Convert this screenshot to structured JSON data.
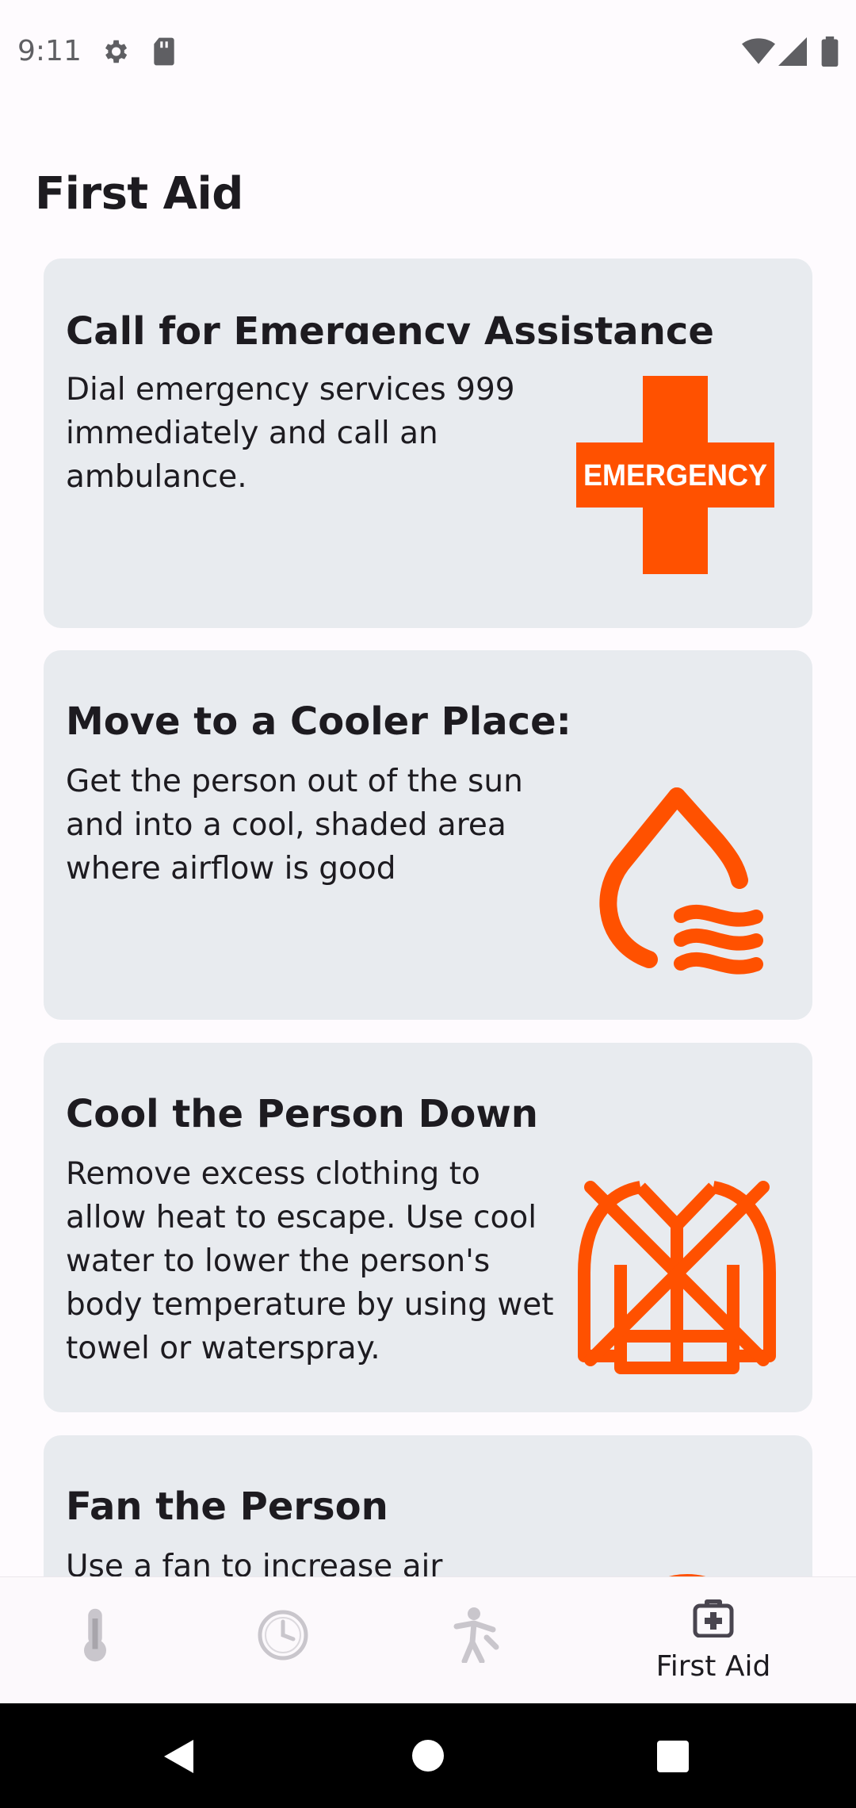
{
  "status_bar": {
    "time": "9:11",
    "icons": [
      "gear-icon",
      "sd-card-icon",
      "wifi-icon",
      "signal-icon",
      "battery-icon"
    ]
  },
  "page": {
    "title": "First Aid"
  },
  "cards": [
    {
      "title": "Call for Emergency Assistance",
      "body": "Dial emergency services 999 immediately and call an ambulance.",
      "icon": "emergency-cross-icon",
      "icon_text": "EMERGENCY"
    },
    {
      "title": "Move to a Cooler Place:",
      "body": "Get the person out of the sun and into a cool, shaded area where airflow is good",
      "icon": "cool-air-drop-icon"
    },
    {
      "title": "Cool the Person Down",
      "body": "Remove excess clothing to allow heat to escape. Use cool water to lower the person's body temperature by using wet towel or waterspray.",
      "icon": "no-jacket-icon"
    },
    {
      "title": "Fan the Person",
      "body": "Use a fan to increase air",
      "icon": "fan-icon"
    }
  ],
  "bottom_nav": {
    "items": [
      {
        "icon": "thermometer-icon",
        "label": ""
      },
      {
        "icon": "clock-icon",
        "label": ""
      },
      {
        "icon": "person-exercise-icon",
        "label": ""
      },
      {
        "icon": "first-aid-kit-icon",
        "label": "First Aid",
        "selected": true
      }
    ]
  },
  "colors": {
    "accent": "#ff5100",
    "card_bg": "#e8ebef",
    "page_bg": "#fefbfe"
  }
}
